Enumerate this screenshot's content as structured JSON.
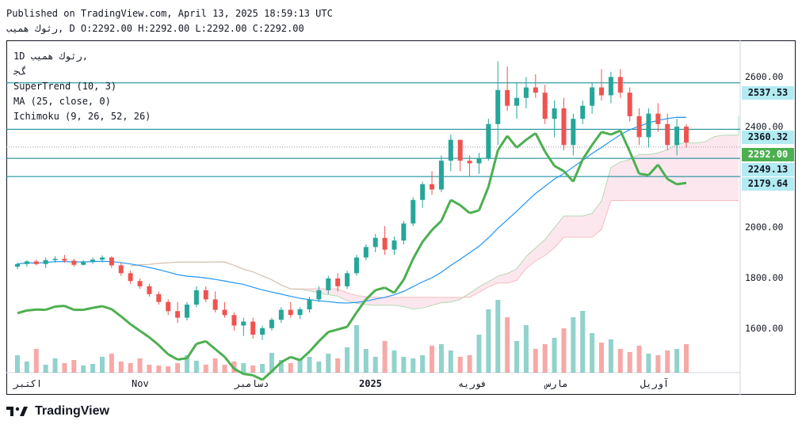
{
  "header": {
    "published": "Published on TradingView.com, April 13, 2025 18:59:13 UTC",
    "ohlc": "رثوك همیب, D O:2292.00 H:2292.00 L:2292.00 C:2292.00"
  },
  "legend": {
    "symbol": "1D  رثوك همیب,",
    "exchange": "ﮓﺟ",
    "supertrend": "SuperTrend (10, 3)",
    "ma": "MA (25, close, 0)",
    "ichimoku": "Ichimoku (9, 26, 52, 26)"
  },
  "price_tags": [
    {
      "label": "2537.53",
      "color": "#b2ebf2"
    },
    {
      "label": "2360.32",
      "color": "#b2ebf2"
    },
    {
      "label": "2292.00",
      "color": "#4caf50"
    },
    {
      "label": "2249.13",
      "color": "#b2ebf2"
    },
    {
      "label": "2179.64",
      "color": "#b2ebf2"
    }
  ],
  "footer": {
    "brand": "TradingView"
  },
  "colors": {
    "up": "#ef5350",
    "down": "#26a69a",
    "ma": "#2196f3",
    "st_up": "#4caf50",
    "st_down": "#a1504e",
    "hline": "#00838f"
  },
  "chart_data": {
    "type": "line",
    "y_ticks": [
      "2600.00",
      "2400.00",
      "2000.00",
      "1800.00",
      "1600.00"
    ],
    "x_ticks": [
      "اکتبر",
      "Nov",
      "دسامبر",
      "2025",
      "فوریه",
      "مارس",
      "آوریل"
    ],
    "ylim": [
      1430,
      2700
    ],
    "horizontal_levels": [
      2537.53,
      2360.32,
      2292.0,
      2249.13,
      2179.64
    ],
    "candles": [
      [
        1835,
        1850,
        1825,
        1845
      ],
      [
        1845,
        1860,
        1835,
        1855
      ],
      [
        1855,
        1862,
        1840,
        1845
      ],
      [
        1845,
        1870,
        1830,
        1860
      ],
      [
        1860,
        1875,
        1850,
        1865
      ],
      [
        1865,
        1880,
        1850,
        1858
      ],
      [
        1858,
        1865,
        1835,
        1842
      ],
      [
        1842,
        1860,
        1840,
        1855
      ],
      [
        1855,
        1870,
        1845,
        1862
      ],
      [
        1862,
        1878,
        1850,
        1870
      ],
      [
        1870,
        1875,
        1830,
        1840
      ],
      [
        1840,
        1850,
        1800,
        1810
      ],
      [
        1810,
        1820,
        1770,
        1780
      ],
      [
        1780,
        1790,
        1750,
        1760
      ],
      [
        1760,
        1770,
        1720,
        1730
      ],
      [
        1730,
        1740,
        1690,
        1700
      ],
      [
        1700,
        1710,
        1650,
        1665
      ],
      [
        1665,
        1700,
        1620,
        1640
      ],
      [
        1640,
        1700,
        1630,
        1690
      ],
      [
        1690,
        1760,
        1680,
        1745
      ],
      [
        1745,
        1760,
        1700,
        1710
      ],
      [
        1710,
        1740,
        1660,
        1670
      ],
      [
        1670,
        1700,
        1640,
        1650
      ],
      [
        1650,
        1660,
        1590,
        1610
      ],
      [
        1610,
        1640,
        1570,
        1625
      ],
      [
        1625,
        1640,
        1560,
        1575
      ],
      [
        1575,
        1610,
        1555,
        1600
      ],
      [
        1600,
        1640,
        1590,
        1632
      ],
      [
        1632,
        1680,
        1620,
        1670
      ],
      [
        1670,
        1700,
        1640,
        1650
      ],
      [
        1650,
        1680,
        1635,
        1672
      ],
      [
        1672,
        1720,
        1660,
        1710
      ],
      [
        1710,
        1760,
        1700,
        1745
      ],
      [
        1745,
        1800,
        1730,
        1790
      ],
      [
        1790,
        1810,
        1740,
        1760
      ],
      [
        1760,
        1820,
        1750,
        1810
      ],
      [
        1810,
        1880,
        1800,
        1870
      ],
      [
        1870,
        1920,
        1860,
        1910
      ],
      [
        1910,
        1960,
        1890,
        1945
      ],
      [
        1945,
        1990,
        1880,
        1900
      ],
      [
        1900,
        1950,
        1880,
        1935
      ],
      [
        1935,
        2010,
        1920,
        2000
      ],
      [
        2000,
        2100,
        1990,
        2090
      ],
      [
        2090,
        2160,
        2060,
        2150
      ],
      [
        2150,
        2200,
        2110,
        2130
      ],
      [
        2130,
        2260,
        2120,
        2240
      ],
      [
        2240,
        2340,
        2200,
        2320
      ],
      [
        2320,
        2300,
        2200,
        2240
      ],
      [
        2240,
        2260,
        2180,
        2230
      ],
      [
        2230,
        2270,
        2190,
        2250
      ],
      [
        2250,
        2400,
        2240,
        2380
      ],
      [
        2380,
        2620,
        2300,
        2510
      ],
      [
        2510,
        2600,
        2430,
        2450
      ],
      [
        2450,
        2540,
        2400,
        2480
      ],
      [
        2480,
        2560,
        2440,
        2520
      ],
      [
        2520,
        2570,
        2480,
        2500
      ],
      [
        2500,
        2530,
        2380,
        2400
      ],
      [
        2400,
        2470,
        2330,
        2440
      ],
      [
        2440,
        2480,
        2280,
        2300
      ],
      [
        2300,
        2420,
        2260,
        2400
      ],
      [
        2400,
        2470,
        2380,
        2450
      ],
      [
        2450,
        2540,
        2420,
        2520
      ],
      [
        2520,
        2590,
        2470,
        2490
      ],
      [
        2490,
        2580,
        2460,
        2560
      ],
      [
        2560,
        2590,
        2480,
        2500
      ],
      [
        2500,
        2520,
        2390,
        2410
      ],
      [
        2410,
        2440,
        2300,
        2330
      ],
      [
        2330,
        2440,
        2290,
        2420
      ],
      [
        2420,
        2460,
        2350,
        2380
      ],
      [
        2380,
        2420,
        2280,
        2300
      ],
      [
        2300,
        2400,
        2260,
        2370
      ],
      [
        2370,
        2380,
        2290,
        2310
      ]
    ],
    "volume_bars": [
      22,
      14,
      30,
      10,
      18,
      12,
      16,
      9,
      11,
      20,
      24,
      14,
      12,
      18,
      10,
      9,
      8,
      12,
      22,
      15,
      10,
      18,
      10,
      14,
      12,
      9,
      11,
      25,
      16,
      12,
      18,
      20,
      14,
      24,
      18,
      32,
      60,
      30,
      20,
      40,
      28,
      20,
      18,
      22,
      34,
      36,
      28,
      20,
      22,
      48,
      80,
      92,
      70,
      40,
      60,
      30,
      36,
      44,
      56,
      70,
      78,
      50,
      38,
      42,
      30,
      26,
      34,
      24,
      22,
      28,
      30,
      36
    ]
  }
}
